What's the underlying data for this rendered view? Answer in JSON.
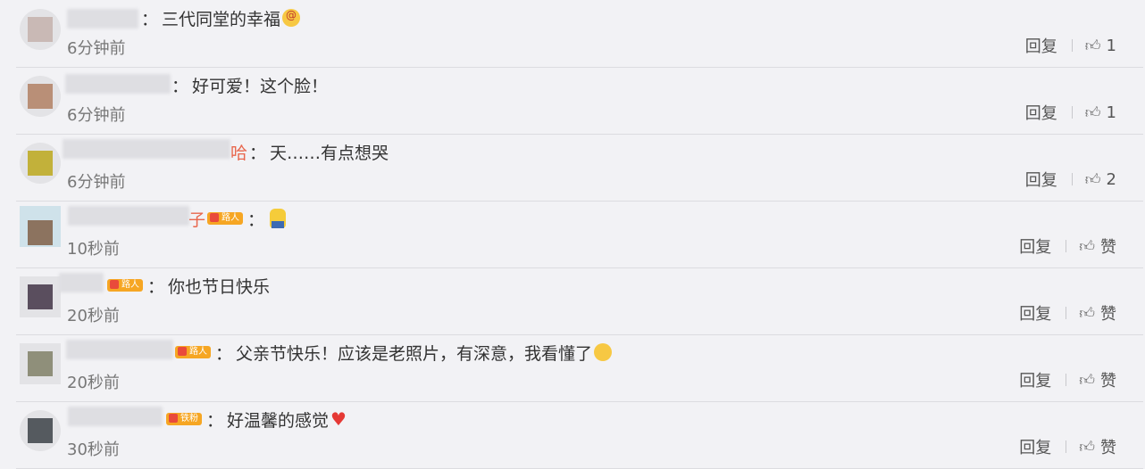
{
  "actions": {
    "reply_label": "回复",
    "like_label_default": "赞"
  },
  "comments": [
    {
      "text": "三代同堂的幸福",
      "time": "6分钟前",
      "likes": "1"
    },
    {
      "text": "好可爱！这个脸！",
      "time": "6分钟前",
      "likes": "1"
    },
    {
      "name_tail": "哈",
      "text": "天……有点想哭",
      "time": "6分钟前",
      "likes": "2"
    },
    {
      "name_tail": "子",
      "badge": "路人",
      "text": "",
      "time": "10秒前",
      "likes": "赞"
    },
    {
      "badge": "路人",
      "text": "你也节日快乐",
      "time": "20秒前",
      "likes": "赞"
    },
    {
      "badge": "路人",
      "text": "父亲节快乐！应该是老照片，有深意，我看懂了",
      "time": "20秒前",
      "likes": "赞"
    },
    {
      "badge": "铁粉",
      "text": "好温馨的感觉",
      "time": "30秒前",
      "likes": "赞"
    }
  ],
  "avatar_colors": [
    "#c9b9b5",
    "#b98f77",
    "#c2b13a",
    "#8c735f",
    "#5a4e5e",
    "#8f8f7a",
    "#555a5f"
  ]
}
